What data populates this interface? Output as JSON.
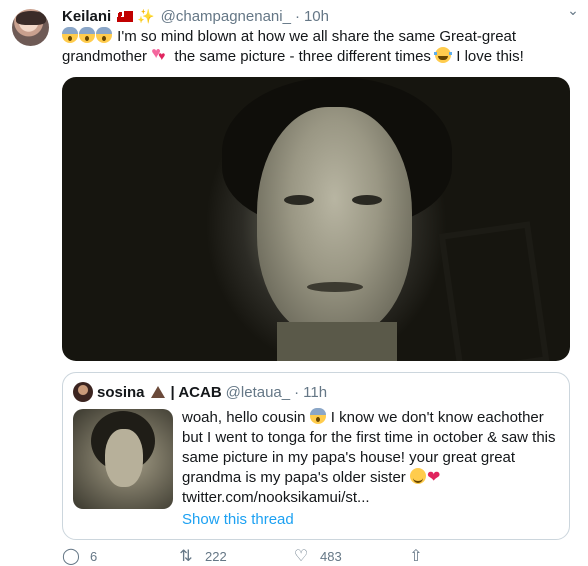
{
  "tweet": {
    "author_name": "Keilani",
    "author_handle": "@champagnenani_",
    "separator": "·",
    "time": "10h",
    "text_part1": "I'm so mind blown at how we all share the same Great-great grandmother",
    "text_part2": "the same picture - three different times",
    "text_part3": "I love this!"
  },
  "quoted": {
    "name": "sosina",
    "name_suffix": "| ACAB",
    "handle": "@letaua_",
    "separator": "·",
    "time": "11h",
    "text_part1": "woah, hello cousin",
    "text_part2": "I know we don't know eachother but I went to tonga for the first time in october & saw this same picture in my papa's house! your great great grandma is my papa's older sister",
    "link": "twitter.com/nooksikamui/st...",
    "show_thread": "Show this thread"
  },
  "actions": {
    "reply_count": "6",
    "retweet_count": "222",
    "like_count": "483"
  },
  "icons": {
    "more": "chevron-down-icon",
    "reply": "reply-icon",
    "retweet": "retweet-icon",
    "like": "heart-icon",
    "share": "share-icon"
  },
  "colors": {
    "link": "#1da1f2",
    "secondary_text": "#657786",
    "border": "#ccd6dd"
  }
}
